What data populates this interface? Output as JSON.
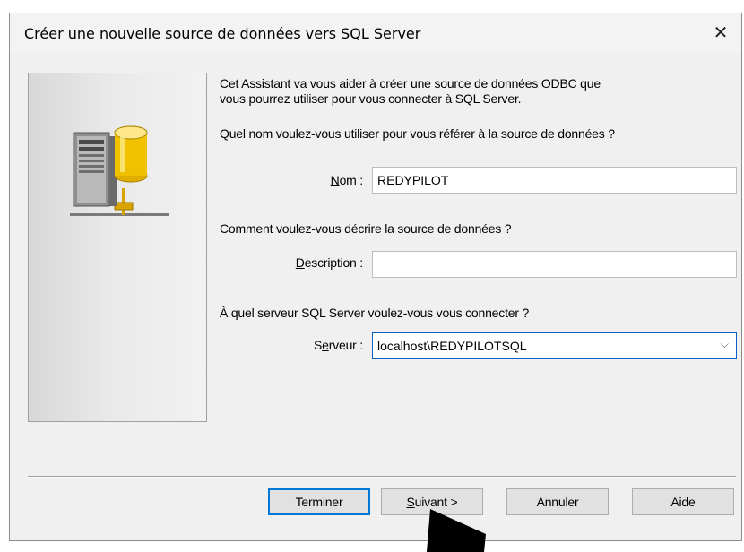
{
  "dialog": {
    "title": "Créer une nouvelle source de données vers SQL Server",
    "close_glyph": "✕",
    "intro_line1": "Cet Assistant va vous aider à créer une source de données ODBC que",
    "intro_line2": "vous pourrez utiliser pour vous connecter à SQL Server.",
    "question_name": "Quel nom voulez-vous utiliser pour vous référer à la source de données ?",
    "name_label_u": "N",
    "name_label_rest": "om :",
    "name_value": "REDYPILOT",
    "question_description": "Comment voulez-vous décrire la source de données ?",
    "description_label_u": "D",
    "description_label_rest": "escription :",
    "description_value": "",
    "question_server": "À quel serveur SQL Server voulez-vous vous connecter ?",
    "server_label_pre": "S",
    "server_label_u": "e",
    "server_label_rest": "rveur :",
    "server_value": "localhost\\REDYPILOTSQL",
    "server_arrow": "⌵"
  },
  "buttons": {
    "finish": "Terminer",
    "next_u": "S",
    "next_rest": "uivant >",
    "cancel": "Annuler",
    "help": "Aide"
  },
  "colors": {
    "accent": "#0078d7",
    "dialog_bg": "#f0f0f0",
    "db_cylinder": "#f2c200"
  }
}
